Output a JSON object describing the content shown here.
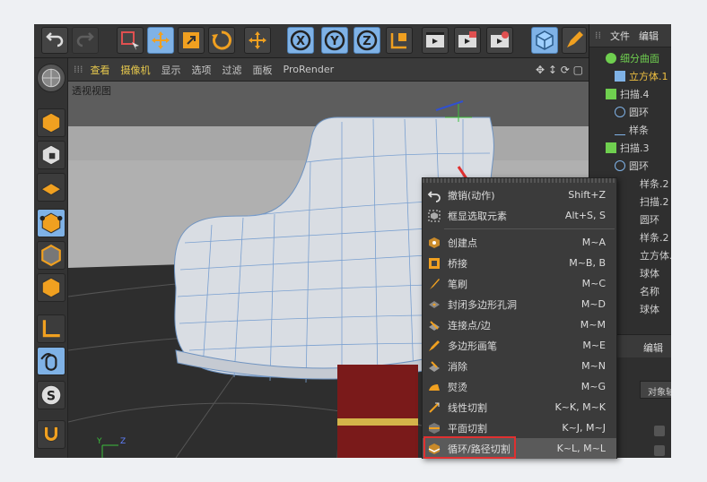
{
  "toolbar": {
    "icons": [
      "undo-icon",
      "redo-icon",
      "live-select-icon",
      "move-icon",
      "scale-icon",
      "rotate-icon",
      "move-icon",
      "x-axis-icon",
      "y-axis-icon",
      "z-axis-icon",
      "coordinate-system-icon",
      "render-view-icon",
      "render-picture-queue-icon",
      "render-settings-icon",
      "cube-icon",
      "pen-icon"
    ],
    "axis_labels": [
      "X",
      "Y",
      "Z"
    ]
  },
  "viewport_menu": {
    "items": [
      "查看",
      "摄像机",
      "显示",
      "选项",
      "过滤",
      "面板",
      "ProRender"
    ],
    "title": "透视视图"
  },
  "right_panel": {
    "menu": [
      "文件",
      "编辑"
    ],
    "tree": [
      "细分曲面",
      "立方体.1",
      "扫描.4",
      "圆环",
      "样条",
      "扫描.3",
      "圆环",
      "样条.2",
      "扫描.2",
      "圆环",
      "样条.2",
      "立方体.1",
      "球体",
      "名称",
      "球体"
    ],
    "props_menu": "编辑",
    "props_field": "对象轴"
  },
  "context_menu": {
    "items": [
      {
        "label": "撤销(动作)",
        "shortcut": "Shift+Z",
        "icon": "undo-action-icon"
      },
      {
        "label": "框显选取元素",
        "shortcut": "Alt+S, S",
        "icon": "frame-selected-icon"
      },
      {
        "label": "创建点",
        "shortcut": "M~A",
        "icon": "create-point-icon"
      },
      {
        "label": "桥接",
        "shortcut": "M~B, B",
        "icon": "bridge-icon"
      },
      {
        "label": "笔刷",
        "shortcut": "M~C",
        "icon": "brush-icon"
      },
      {
        "label": "封闭多边形孔洞",
        "shortcut": "M~D",
        "icon": "close-polygon-hole-icon"
      },
      {
        "label": "连接点/边",
        "shortcut": "M~M",
        "icon": "connect-points-edges-icon"
      },
      {
        "label": "多边形画笔",
        "shortcut": "M~E",
        "icon": "polygon-pen-icon"
      },
      {
        "label": "消除",
        "shortcut": "M~N",
        "icon": "dissolve-icon"
      },
      {
        "label": "熨烫",
        "shortcut": "M~G",
        "icon": "iron-icon"
      },
      {
        "label": "线性切割",
        "shortcut": "K~K, M~K",
        "icon": "line-cut-icon"
      },
      {
        "label": "平面切割",
        "shortcut": "K~J, M~J",
        "icon": "plane-cut-icon"
      },
      {
        "label": "循环/路径切割",
        "shortcut": "K~L, M~L",
        "icon": "loop-path-cut-icon"
      }
    ]
  },
  "colors": {
    "accent": "#7fb2e6",
    "highlight": "#e6c84d",
    "bg": "#2b2b2b",
    "selected_outline": "#e03030"
  }
}
